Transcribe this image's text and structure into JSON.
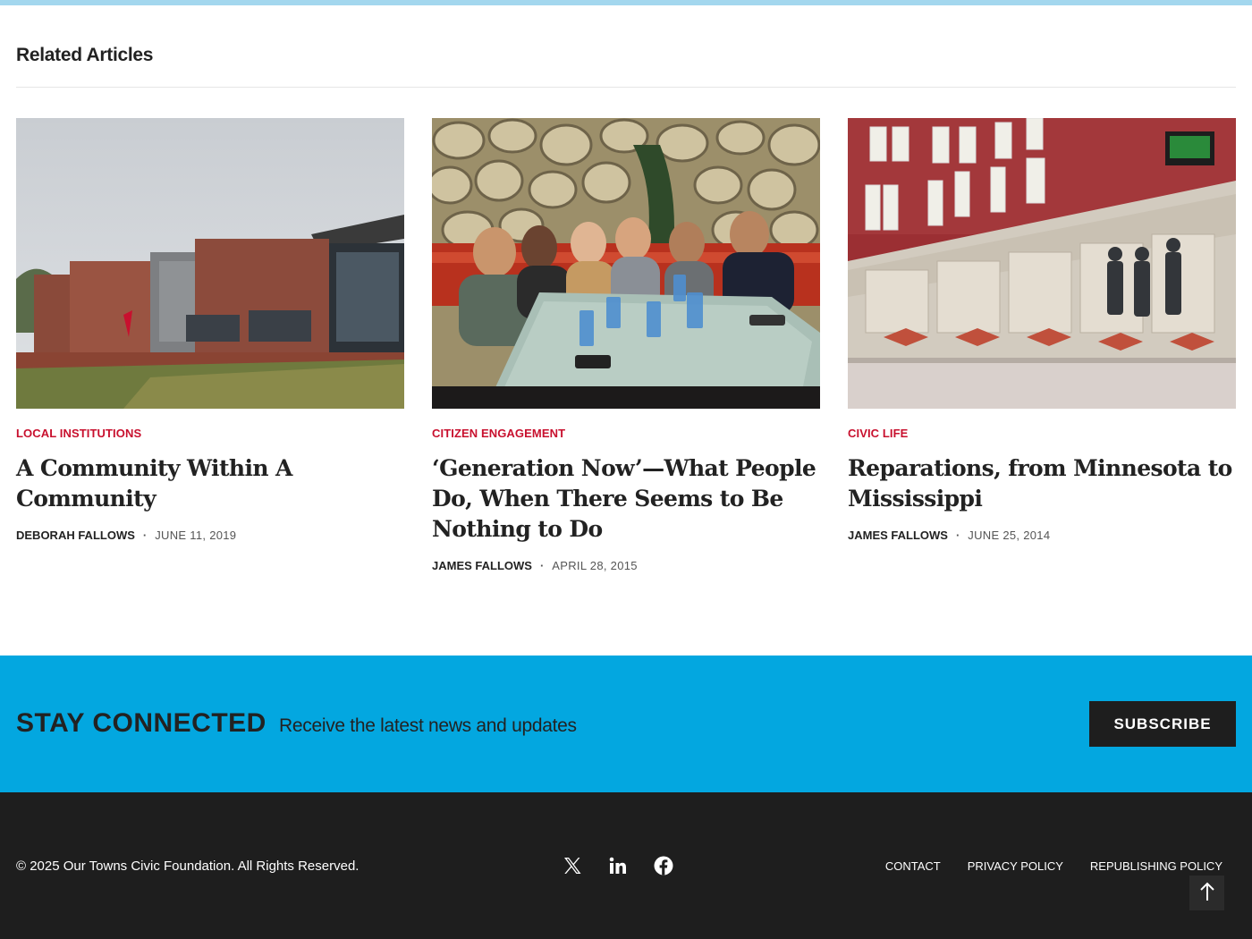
{
  "related": {
    "title": "Related Articles",
    "articles": [
      {
        "category": "LOCAL INSTITUTIONS",
        "title": "A Community Within A Community",
        "author": "DEBORAH FALLOWS",
        "date": "JUNE 11, 2019",
        "image": "ymca-building-photo"
      },
      {
        "category": "CITIZEN ENGAGEMENT",
        "title": "‘Generation Now’—What People Do, When There Seems to Be Nothing to Do",
        "author": "JAMES FALLOWS",
        "date": "APRIL 28, 2015",
        "image": "group-dinner-photo"
      },
      {
        "category": "CIVIC LIFE",
        "title": "Reparations, from Minnesota to Mississippi",
        "author": "JAMES FALLOWS",
        "date": "JUNE 25, 2014",
        "image": "memorial-wall-photo"
      }
    ]
  },
  "stay_connected": {
    "title": "STAY CONNECTED",
    "subtitle": "Receive the latest news and updates",
    "button": "SUBSCRIBE",
    "background": "#03a7e0"
  },
  "footer": {
    "copyright": "© 2025 Our Towns Civic Foundation. All Rights Reserved.",
    "social_icons": [
      "x-icon",
      "linkedin-icon",
      "facebook-icon"
    ],
    "links": [
      "CONTACT",
      "PRIVACY POLICY",
      "REPUBLISHING POLICY"
    ],
    "back_to_top_icon": "arrow-up-icon",
    "background": "#1e1e1e"
  },
  "colors": {
    "category": "#c8102e",
    "top_bar": "#a3d7ee"
  }
}
